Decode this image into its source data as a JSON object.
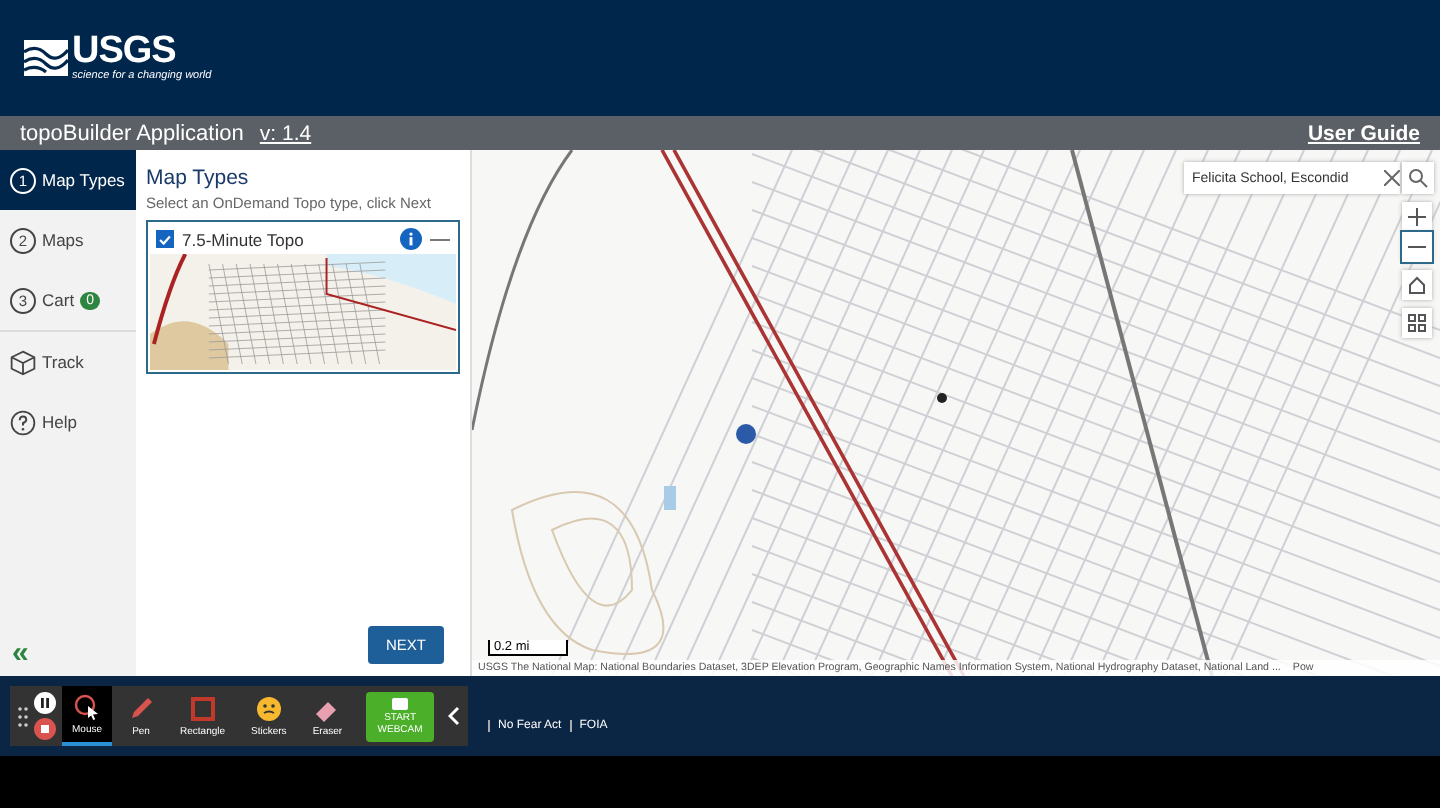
{
  "header": {
    "logo_text": "USGS",
    "tagline": "science for a changing world"
  },
  "app_bar": {
    "title": "topoBuilder Application",
    "version": "v: 1.4",
    "user_guide": "User Guide"
  },
  "steps": [
    {
      "kind": "number",
      "number": "1",
      "label": "Map Types",
      "selected": true
    },
    {
      "kind": "number",
      "number": "2",
      "label": "Maps",
      "selected": false
    },
    {
      "kind": "number",
      "number": "3",
      "label": "Cart",
      "badge": "0",
      "selected": false
    },
    {
      "kind": "track",
      "label": "Track",
      "selected": false
    },
    {
      "kind": "help",
      "label": "Help",
      "selected": false
    }
  ],
  "collapse": "«",
  "panel": {
    "title": "Map Types",
    "instruction": "Select an OnDemand Topo type, click Next",
    "options": [
      {
        "label": "7.5-Minute Topo",
        "checked": true
      }
    ],
    "next": "NEXT"
  },
  "map": {
    "search": {
      "value": "Felicita School, Escondid"
    },
    "scale": "0.2 mi",
    "attribution": "USGS The National Map: National Boundaries Dataset, 3DEP Elevation Program, Geographic Names Information System, National Hydrography Dataset, National Land ...",
    "powered": "Pow"
  },
  "footer": {
    "links": [
      "No Fear Act",
      "FOIA"
    ]
  },
  "recorder": {
    "tools": [
      {
        "kind": "mouse",
        "label": "Mouse",
        "selected": true
      },
      {
        "kind": "pen",
        "label": "Pen",
        "selected": false
      },
      {
        "kind": "rectangle",
        "label": "Rectangle",
        "selected": false
      },
      {
        "kind": "stickers",
        "label": "Stickers",
        "selected": false
      },
      {
        "kind": "eraser",
        "label": "Eraser",
        "selected": false
      }
    ],
    "webcam": "START WEBCAM"
  }
}
